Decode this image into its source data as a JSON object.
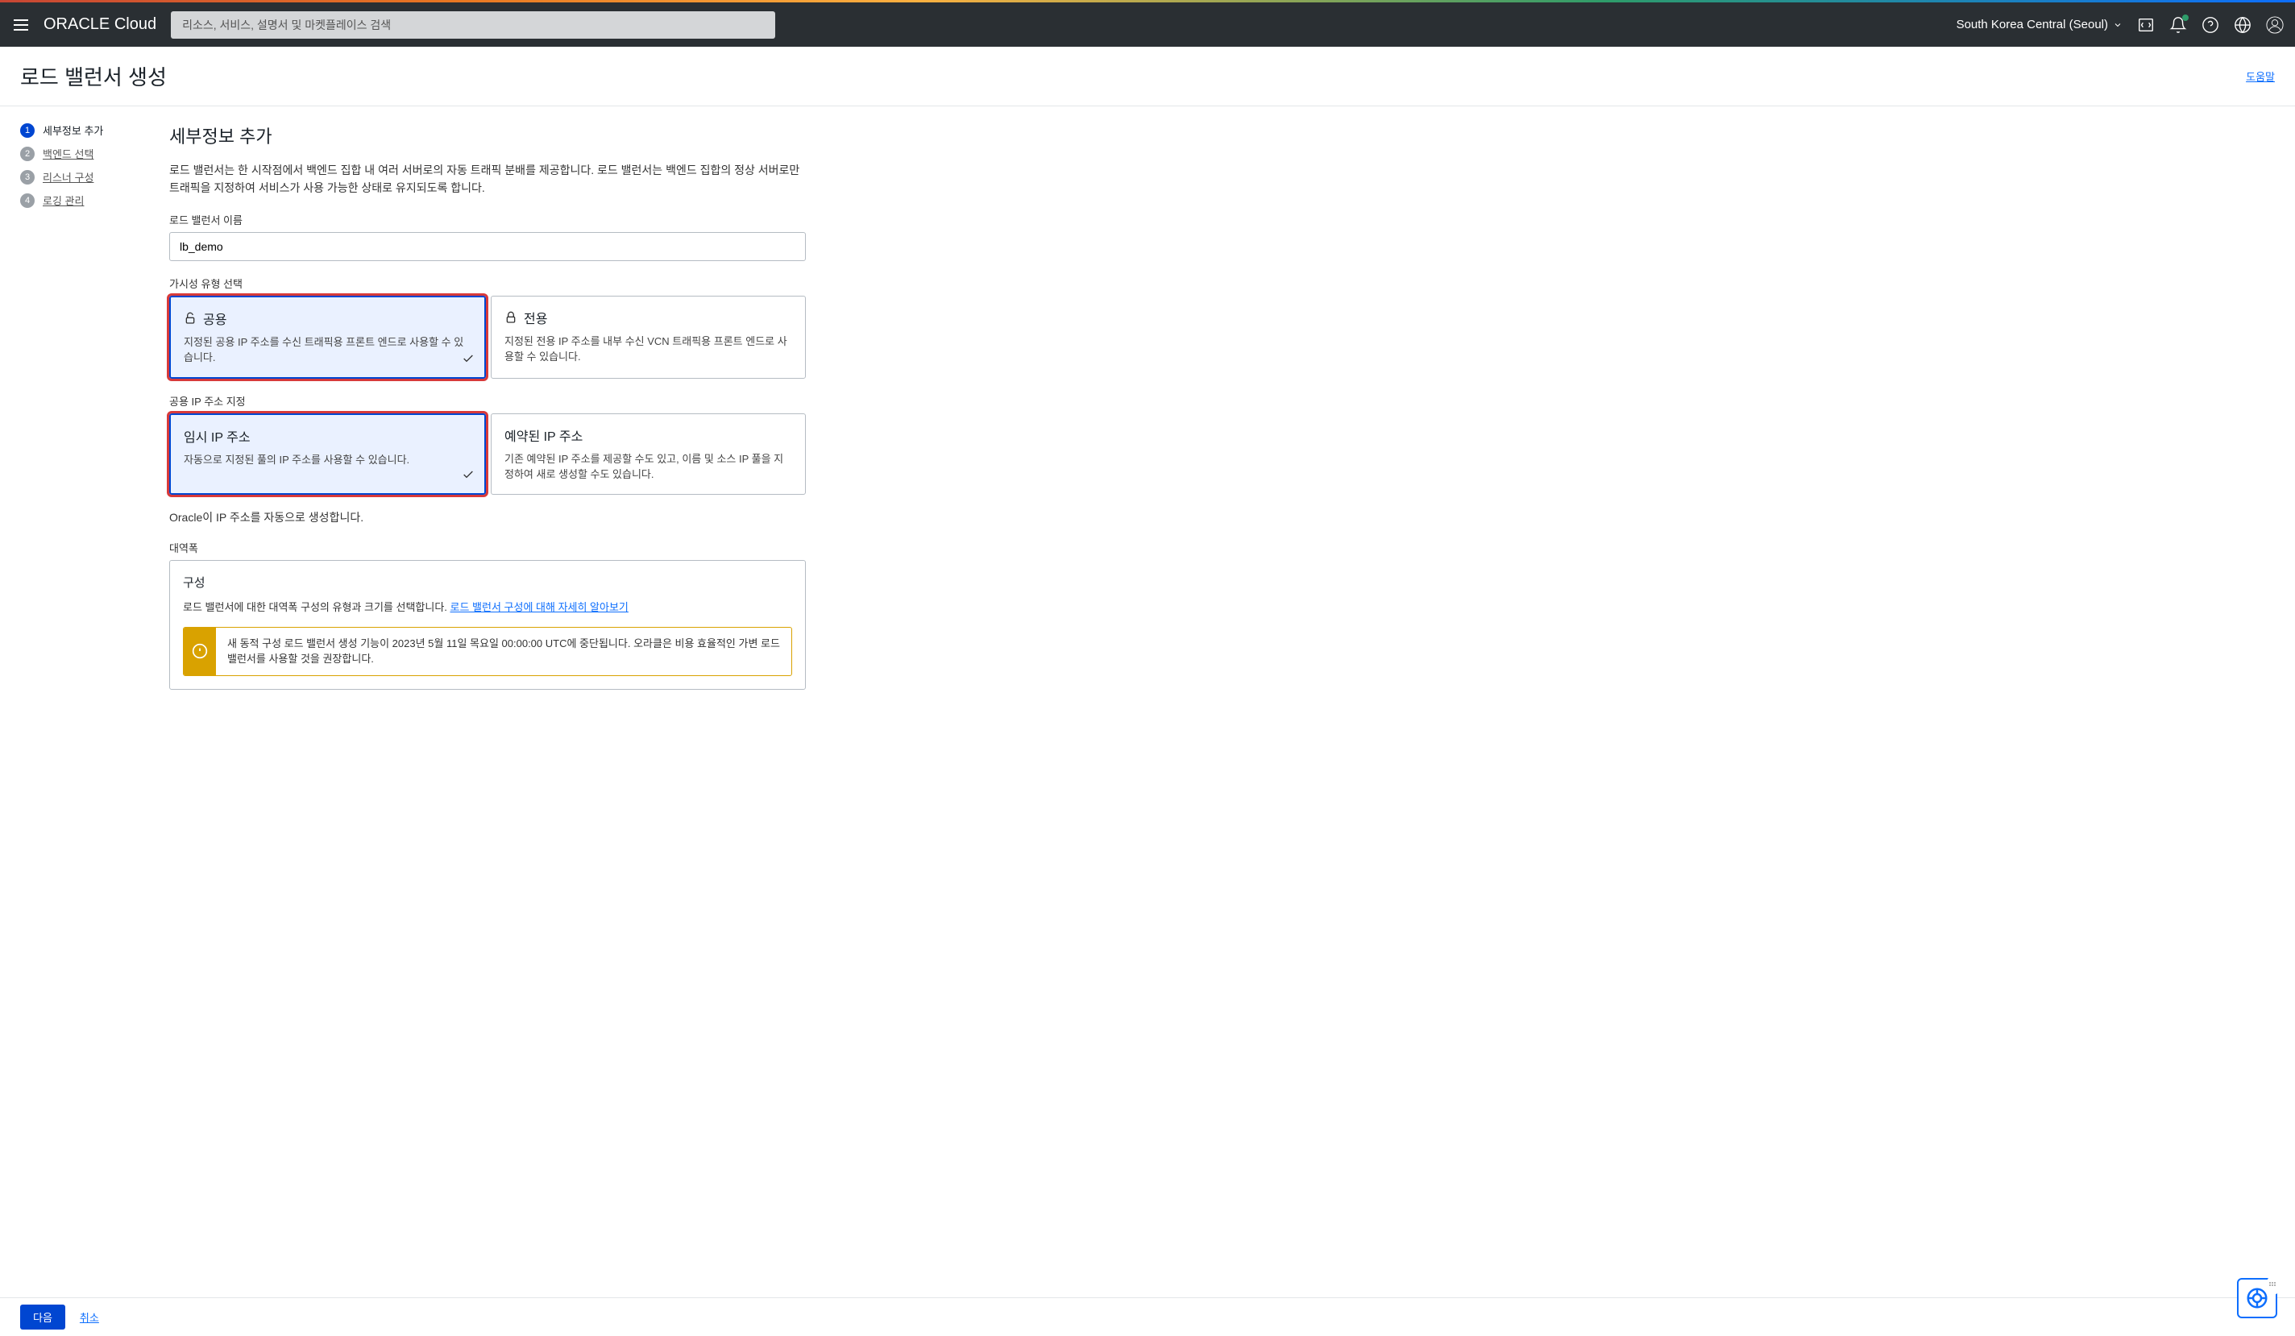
{
  "header": {
    "logo_bold": "ORACLE",
    "logo_thin": "Cloud",
    "search_placeholder": "리소스, 서비스, 설명서 및 마켓플레이스 검색",
    "region": "South Korea Central (Seoul)"
  },
  "title_bar": {
    "title": "로드 밸런서 생성",
    "help": "도움말"
  },
  "steps": [
    {
      "num": "1",
      "label": "세부정보 추가",
      "active": true
    },
    {
      "num": "2",
      "label": "백엔드 선택",
      "active": false
    },
    {
      "num": "3",
      "label": "리스너 구성",
      "active": false
    },
    {
      "num": "4",
      "label": "로깅 관리",
      "active": false
    }
  ],
  "main": {
    "section_title": "세부정보 추가",
    "description": "로드 밸런서는 한 시작점에서 백엔드 집합 내 여러 서버로의 자동 트래픽 분배를 제공합니다. 로드 밸런서는 백엔드 집합의 정상 서버로만 트래픽을 지정하여 서비스가 사용 가능한 상태로 유지되도록 합니다.",
    "name_label": "로드 밸런서 이름",
    "name_value": "lb_demo",
    "visibility_label": "가시성 유형 선택",
    "visibility_options": [
      {
        "title": "공용",
        "desc": "지정된 공용 IP 주소를 수신 트래픽용 프론트 엔드로 사용할 수 있습니다.",
        "selected": true,
        "highlighted": true,
        "icon": "unlock"
      },
      {
        "title": "전용",
        "desc": "지정된 전용 IP 주소를 내부 수신 VCN 트래픽용 프론트 엔드로 사용할 수 있습니다.",
        "selected": false,
        "highlighted": false,
        "icon": "lock"
      }
    ],
    "ip_label": "공용 IP 주소 지정",
    "ip_options": [
      {
        "title": "임시 IP 주소",
        "desc": "자동으로 지정된 풀의 IP 주소를 사용할 수 있습니다.",
        "selected": true,
        "highlighted": true
      },
      {
        "title": "예약된 IP 주소",
        "desc": "기존 예약된 IP 주소를 제공할 수도 있고, 이름 및 소스 IP 풀을 지정하여 새로 생성할 수도 있습니다.",
        "selected": false,
        "highlighted": false
      }
    ],
    "ip_info": "Oracle이 IP 주소를 자동으로 생성합니다.",
    "bandwidth_label": "대역폭",
    "config": {
      "title": "구성",
      "desc": "로드 밸런서에 대한 대역폭 구성의 유형과 크기를 선택합니다. ",
      "link": "로드 밸런서 구성에 대해 자세히 알아보기",
      "warning": "새 동적 구성 로드 밸런서 생성 기능이 2023년 5월 11일 목요일 00:00:00 UTC에 중단됩니다. 오라클은 비용 효율적인 가변 로드 밸런서를 사용할 것을 권장합니다."
    }
  },
  "footer": {
    "next": "다음",
    "cancel": "취소"
  }
}
